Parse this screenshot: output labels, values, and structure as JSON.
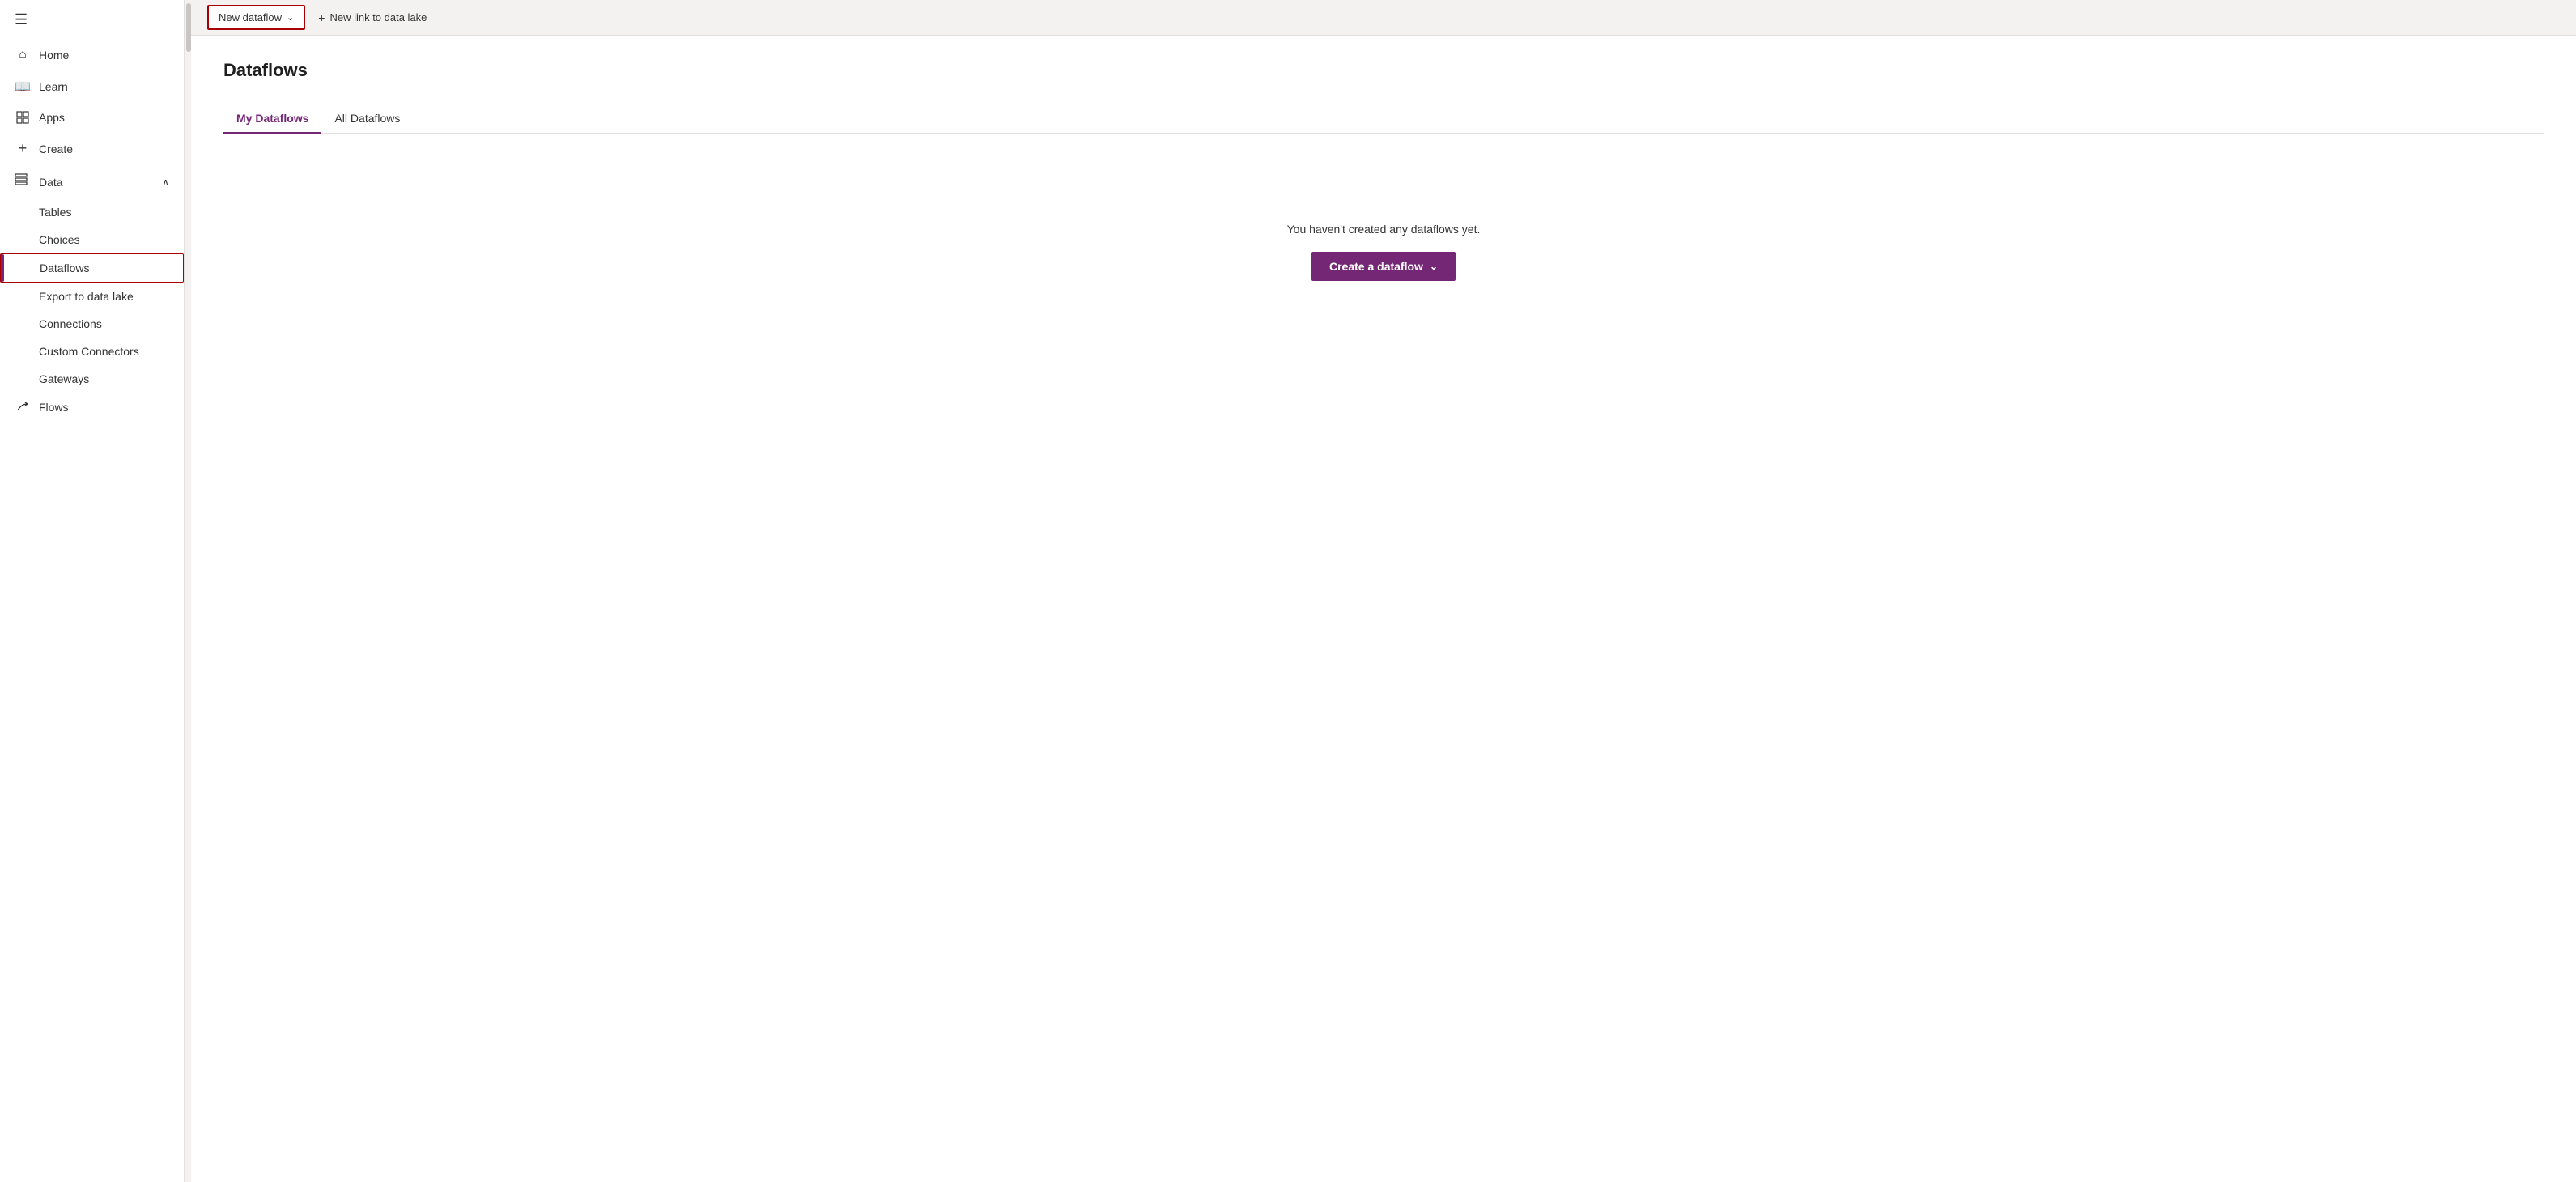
{
  "sidebar": {
    "hamburger_icon": "☰",
    "items": [
      {
        "id": "home",
        "label": "Home",
        "icon": "⌂"
      },
      {
        "id": "learn",
        "label": "Learn",
        "icon": "📖"
      },
      {
        "id": "apps",
        "label": "Apps",
        "icon": "⊞"
      },
      {
        "id": "create",
        "label": "Create",
        "icon": "+"
      },
      {
        "id": "data",
        "label": "Data",
        "icon": "⊟",
        "hasChevron": true,
        "expanded": true
      }
    ],
    "sub_items": [
      {
        "id": "tables",
        "label": "Tables"
      },
      {
        "id": "choices",
        "label": "Choices"
      },
      {
        "id": "dataflows",
        "label": "Dataflows",
        "active": true
      },
      {
        "id": "export-to-data-lake",
        "label": "Export to data lake"
      },
      {
        "id": "connections",
        "label": "Connections"
      },
      {
        "id": "custom-connectors",
        "label": "Custom Connectors"
      },
      {
        "id": "gateways",
        "label": "Gateways"
      }
    ],
    "bottom_items": [
      {
        "id": "flows",
        "label": "Flows",
        "icon": "⤴"
      }
    ]
  },
  "toolbar": {
    "new_dataflow_label": "New dataflow",
    "new_dataflow_dropdown_arrow": "⌄",
    "new_link_icon": "+",
    "new_link_label": "New link to data lake"
  },
  "page": {
    "title": "Dataflows",
    "tabs": [
      {
        "id": "my-dataflows",
        "label": "My Dataflows",
        "active": true
      },
      {
        "id": "all-dataflows",
        "label": "All Dataflows",
        "active": false
      }
    ],
    "empty_state": {
      "message": "You haven't created any dataflows yet.",
      "create_button_label": "Create a dataflow",
      "create_button_arrow": "⌄"
    }
  }
}
